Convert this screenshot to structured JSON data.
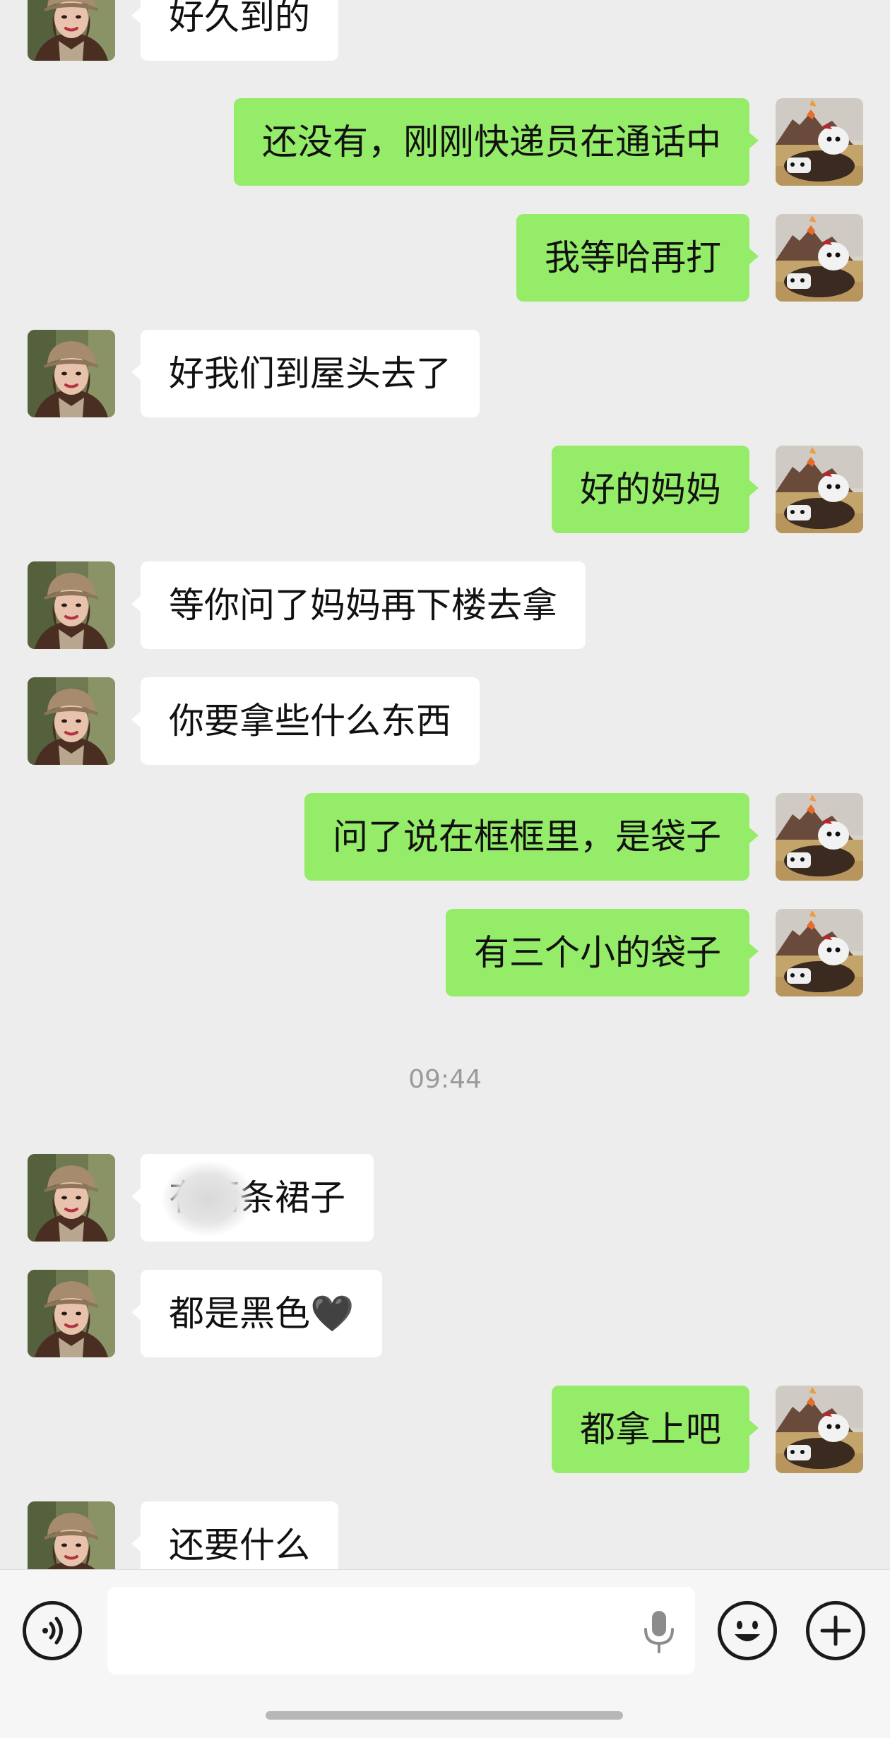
{
  "chat": {
    "messages": [
      {
        "side": "left",
        "text": "好久到的"
      },
      {
        "side": "right",
        "text": "还没有，刚刚快递员在通话中"
      },
      {
        "side": "right",
        "text": "我等哈再打"
      },
      {
        "side": "left",
        "text": "好我们到屋头去了"
      },
      {
        "side": "right",
        "text": "好的妈妈"
      },
      {
        "side": "left",
        "text": "等你问了妈妈再下楼去拿"
      },
      {
        "side": "left",
        "text": "你要拿些什么东西"
      },
      {
        "side": "right",
        "text": "问了说在框框里，是袋子"
      },
      {
        "side": "right",
        "text": "有三个小的袋子"
      },
      {
        "side": "left",
        "text": "有俩条裙子"
      },
      {
        "side": "left",
        "text": "都是黑色🖤"
      },
      {
        "side": "right",
        "text": "都拿上吧"
      },
      {
        "side": "left",
        "text": "还要什么"
      }
    ],
    "timestamp": "09:44"
  },
  "icons": {
    "voice": "voice-input-icon",
    "microphone": "microphone-icon",
    "emoji": "emoji-icon",
    "more": "plus-icon"
  },
  "colors": {
    "background": "#ededed",
    "sent_bubble": "#95ec69",
    "received_bubble": "#ffffff"
  }
}
